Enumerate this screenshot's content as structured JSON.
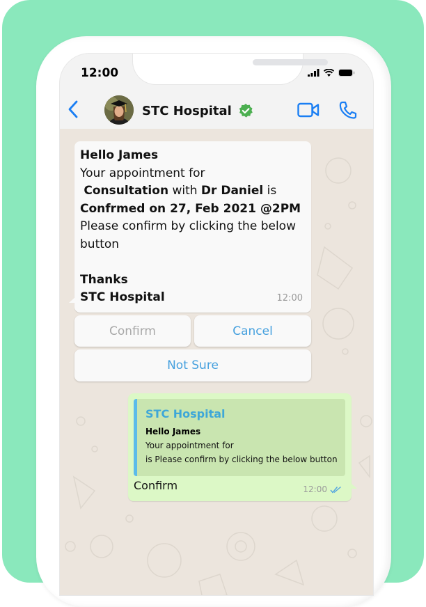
{
  "status_bar": {
    "time": "12:00"
  },
  "header": {
    "contact_name": "STC Hospital",
    "icons": [
      "back-chevron-icon",
      "avatar",
      "verified-badge-icon",
      "video-call-icon",
      "voice-call-icon"
    ]
  },
  "incoming_message": {
    "greeting": "Hello James",
    "line1": "Your appointment for",
    "service": "Consultation",
    "with_word": " with ",
    "doctor": "Dr Daniel",
    "is_word": " is",
    "confirmation": "Confrmed on 27, Feb 2021 @2PM",
    "instruction": "Please confirm by clicking the below button",
    "thanks": "Thanks",
    "signature": "STC Hospital",
    "timestamp": "12:00"
  },
  "quick_replies": [
    {
      "label": "Confirm",
      "state": "disabled"
    },
    {
      "label": "Cancel"
    },
    {
      "label": "Not Sure"
    }
  ],
  "outgoing_message": {
    "quoted": {
      "sender": "STC Hospital",
      "line1": "Hello James",
      "line2": "Your appointment for",
      "line3": "is Please confirm by clicking the below button"
    },
    "text": "Confirm",
    "timestamp": "12:00",
    "status": "read"
  },
  "colors": {
    "background": "#8ae8bc",
    "accent_blue": "#1a7ef3",
    "verified_green": "#4caf50",
    "outgoing_bubble": "#dcf8c6",
    "quote_bar": "#5bbbea"
  }
}
